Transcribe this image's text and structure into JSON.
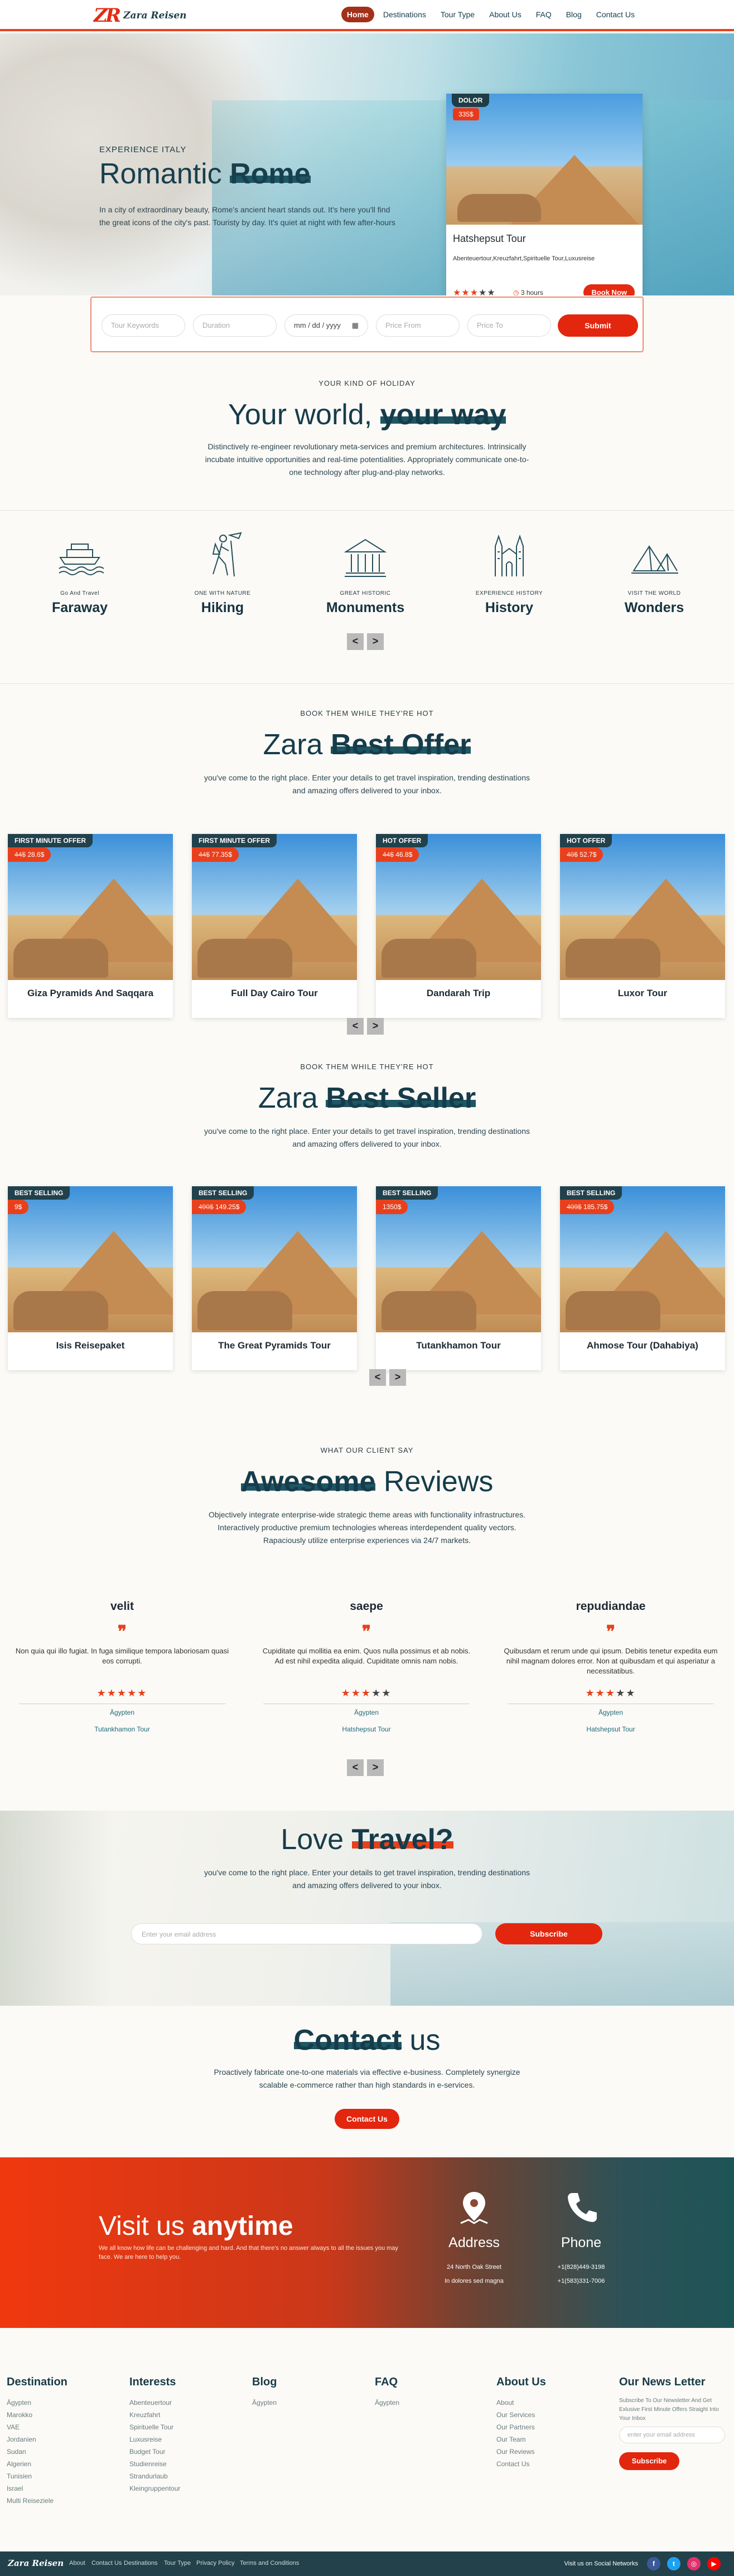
{
  "nav": {
    "logo_mark": "ZR",
    "logo_text": "Zara Reisen",
    "links": [
      "Home",
      "Destinations",
      "Tour Type",
      "About Us",
      "FAQ",
      "Blog",
      "Contact Us"
    ]
  },
  "hero": {
    "kicker": "EXPERIENCE ITALY",
    "title_a": "Romantic ",
    "title_b": "Rome",
    "text": "In a city of extraordinary beauty, Rome's ancient heart stands out. It's here you'll find the great icons of the city's past. Touristy by day. It's quiet at night with few after-hours",
    "card": {
      "badge": "DOLOR",
      "price": "335$",
      "title": "Hatshepsut Tour",
      "sub": "Abenteuertour,Kreuzfahrt,Spirituelle Tour,Luxusreise",
      "rating": 3,
      "duration": "3 hours",
      "book": "Book Now"
    }
  },
  "search": {
    "keywords": "Tour Keywords",
    "duration": "Duration",
    "date": "mm / dd / yyyy",
    "price_from": "Price From",
    "price_to": "Price To",
    "submit": "Submit"
  },
  "holiday": {
    "kicker": "YOUR KIND OF HOLIDAY",
    "title_a": "Your world, ",
    "title_b": "your way",
    "lead": "Distinctively re-engineer revolutionary meta-services and premium architectures. Intrinsically incubate intuitive opportunities and real-time potentialities. Appropriately communicate one-to-one technology after plug-and-play networks.",
    "categories": [
      {
        "small": "Go And Travel",
        "big": "Faraway",
        "icon": "boat-icon"
      },
      {
        "small": "ONE WITH NATURE",
        "big": "Hiking",
        "icon": "hiker-icon"
      },
      {
        "small": "GREAT HISTORIC",
        "big": "Monuments",
        "icon": "temple-icon"
      },
      {
        "small": "EXPERIENCE HISTORY",
        "big": "History",
        "icon": "cathedral-icon"
      },
      {
        "small": "VISIT THE WORLD",
        "big": "Wonders",
        "icon": "pyramids-icon"
      }
    ]
  },
  "offer": {
    "kicker": "BOOK THEM WHILE THEY'RE HOT",
    "title_a": "Zara ",
    "title_b": "Best Offer",
    "lead": "you've come to the right place. Enter your details to get travel inspiration, trending destinations and amazing offers delivered to your inbox.",
    "items": [
      {
        "tag": "FIRST MINUTE OFFER",
        "old": "44$",
        "price": "28.6$",
        "name": "Giza Pyramids And Saqqara"
      },
      {
        "tag": "FIRST MINUTE OFFER",
        "old": "44$",
        "price": "77.35$",
        "name": "Full Day Cairo Tour"
      },
      {
        "tag": "HOT OFFER",
        "old": "44$",
        "price": "46.8$",
        "name": "Dandarah Trip"
      },
      {
        "tag": "HOT OFFER",
        "old": "40$",
        "price": "52.7$",
        "name": "Luxor Tour"
      }
    ]
  },
  "seller": {
    "kicker": "BOOK THEM WHILE THEY'RE HOT",
    "title_a": "Zara ",
    "title_b": "Best Seller",
    "lead": "you've come to the right place. Enter your details to get travel inspiration, trending destinations and amazing offers delivered to your inbox.",
    "items": [
      {
        "tag": "BEST SELLING",
        "old": "",
        "price": "9$",
        "name": "Isis Reisepaket"
      },
      {
        "tag": "BEST SELLING",
        "old": "490$",
        "price": "149.25$",
        "name": "The Great Pyramids Tour"
      },
      {
        "tag": "BEST SELLING",
        "old": "",
        "price": "1350$",
        "name": "Tutankhamon Tour"
      },
      {
        "tag": "BEST SELLING",
        "old": "409$",
        "price": "185.75$",
        "name": "Ahmose Tour (Dahabiya)"
      }
    ]
  },
  "reviews": {
    "kicker": "WHAT OUR CLIENT SAY",
    "title_a": "Awesome",
    "title_b": " Reviews",
    "lead": "Objectively integrate enterprise-wide strategic theme areas with functionality infrastructures. Interactively productive premium technologies whereas interdependent quality vectors. Rapaciously utilize enterprise experiences via 24/7 markets.",
    "items": [
      {
        "name": "velit",
        "text": "Non quia qui illo fugiat. In fuga similique tempora laboriosam quasi eos corrupti.",
        "rating": 5,
        "country": "Ägypten",
        "tour": "Tutankhamon Tour"
      },
      {
        "name": "saepe",
        "text": "Cupiditate qui mollitia ea enim. Quos nulla possimus et ab nobis. Ad est nihil expedita aliquid. Cupiditate omnis nam nobis.",
        "rating": 3,
        "country": "Ägypten",
        "tour": "Hatshepsut Tour"
      },
      {
        "name": "repudiandae",
        "text": "Quibusdam et rerum unde qui ipsum. Debitis tenetur expedita eum nihil magnam dolores error. Non at quibusdam et qui asperiatur a necessitatibus.",
        "rating": 3,
        "country": "Ägypten",
        "tour": "Hatshepsut Tour"
      }
    ]
  },
  "love": {
    "title_a": "Love ",
    "title_b": "Travel?",
    "lead": "you've come to the right place. Enter your details to get travel inspiration, trending destinations and amazing offers delivered to your inbox.",
    "placeholder": "Enter your email address",
    "subscribe": "Subscribe"
  },
  "contact": {
    "title_a": "Contact",
    "title_b": " us",
    "lead": "Proactively fabricate one-to-one materials via effective e-business. Completely synergize scalable e-commerce rather than high standards in e-services.",
    "button": "Contact Us"
  },
  "visit": {
    "title_a": "Visit us  ",
    "title_b": "anytime",
    "text": "We all know how life can be challenging and hard. And that there's no answer always to all the issues you may face. We are here to help you.",
    "address_h": "Address",
    "address_1": "24 North Oak Street",
    "address_2": "In dolores sed magna",
    "phone_h": "Phone",
    "phone_1": "+1(828)449-3198",
    "phone_2": "+1(583)331-7006"
  },
  "footer": {
    "destination": {
      "title": "Destination",
      "items": [
        "Ägypten",
        "Marokko",
        "VAE",
        "Jordanien",
        "Sudan",
        "Algerien",
        "Tunisien",
        "Israel",
        "Multi Reiseziele"
      ]
    },
    "interests": {
      "title": "Interests",
      "items": [
        "Abenteuertour",
        "Kreuzfahrt",
        "Spirituelle Tour",
        "Luxusreise",
        "Budget Tour",
        "Studienreise",
        "Strandurlaub",
        "Kleingruppentour"
      ]
    },
    "blog": {
      "title": "Blog",
      "items": [
        "Ägypten"
      ]
    },
    "faq": {
      "title": "FAQ",
      "items": [
        "Ägypten"
      ]
    },
    "about": {
      "title": "About Us",
      "items": [
        "About",
        "Our Services",
        "Our Partners",
        "Our Team",
        "Our Reviews",
        "Contact Us"
      ]
    },
    "news": {
      "title": "Our News Letter",
      "text": "Subscribe To Our Newsletter And Get Exlusive First Minute Offers Straight Into Your Inbox",
      "placeholder": "enter your email address",
      "button": "Subscribe"
    },
    "bar": {
      "logo": "Zara Reisen",
      "links": [
        "About",
        "Contact Us",
        "Destinations",
        "Tour Type",
        "Privacy Policy",
        "Terms and Conditions"
      ],
      "social_label": "Visit us on Social Networks"
    }
  },
  "colors": {
    "accent": "#e3260e",
    "dark": "#163c4b"
  }
}
